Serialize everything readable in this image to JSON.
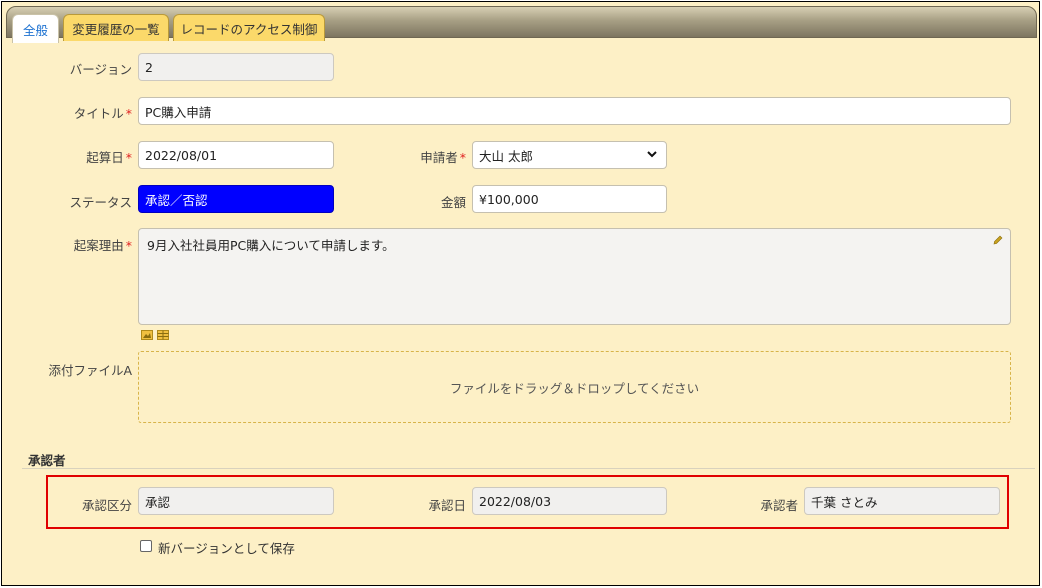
{
  "tabs": [
    {
      "label": "全般",
      "active": true
    },
    {
      "label": "変更履歴の一覧",
      "active": false
    },
    {
      "label": "レコードのアクセス制御",
      "active": false
    }
  ],
  "fields": {
    "version": {
      "label": "バージョン",
      "value": "2"
    },
    "title": {
      "label": "タイトル",
      "value": "PC購入申請",
      "required": "*"
    },
    "start_date": {
      "label": "起算日",
      "value": "2022/08/01",
      "required": "*"
    },
    "applicant": {
      "label": "申請者",
      "value": "大山 太郎",
      "required": "*"
    },
    "status": {
      "label": "ステータス",
      "value": "承認／否認"
    },
    "amount": {
      "label": "金額",
      "value": "¥100,000"
    },
    "reason": {
      "label": "起案理由",
      "value": "9月入社社員用PC購入について申請します。",
      "required": "*"
    },
    "attachment": {
      "label": "添付ファイルA",
      "placeholder": "ファイルをドラッグ＆ドロップしてください"
    }
  },
  "approver_section": {
    "title": "承認者",
    "approval_type": {
      "label": "承認区分",
      "value": "承認"
    },
    "approval_date": {
      "label": "承認日",
      "value": "2022/08/03"
    },
    "approver": {
      "label": "承認者",
      "value": "千葉 さとみ"
    }
  },
  "save_new_version": {
    "label": "新バージョンとして保存",
    "checked": false
  },
  "colors": {
    "background": "#fdf0c6",
    "tab": "#fbd96a",
    "active_tab_text": "#1d72d1",
    "status_bg": "#0000ff",
    "required": "#e02020",
    "highlight": "#e00000"
  }
}
